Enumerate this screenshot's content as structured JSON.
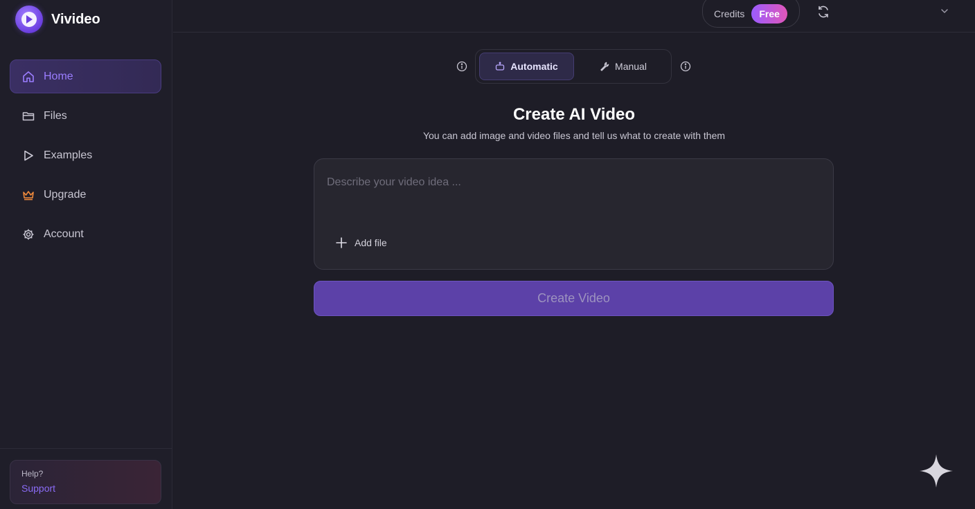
{
  "brand": {
    "name": "Vivideo",
    "accent": "#7b4fff"
  },
  "sidebar": {
    "items": [
      {
        "label": "Home",
        "icon": "home-icon",
        "active": true
      },
      {
        "label": "Files",
        "icon": "folder-icon",
        "active": false
      },
      {
        "label": "Examples",
        "icon": "play-outline-icon",
        "active": false
      },
      {
        "label": "Upgrade",
        "icon": "crown-icon",
        "active": false
      },
      {
        "label": "Account",
        "icon": "gear-icon",
        "active": false
      }
    ],
    "help": {
      "question": "Help?",
      "link": "Support"
    }
  },
  "topbar": {
    "credits_label": "Credits",
    "plan_badge": "Free",
    "refresh_icon": "refresh-icon",
    "menu_icon": "chevron-down-icon"
  },
  "mode": {
    "automatic": "Automatic",
    "manual": "Manual",
    "selected": "Automatic"
  },
  "main": {
    "title": "Create AI Video",
    "subtitle": "You can add image and video files and tell us what to create with them",
    "prompt_placeholder": "Describe your video idea ...",
    "prompt_value": "",
    "add_file_label": "Add file",
    "create_button": "Create Video"
  }
}
